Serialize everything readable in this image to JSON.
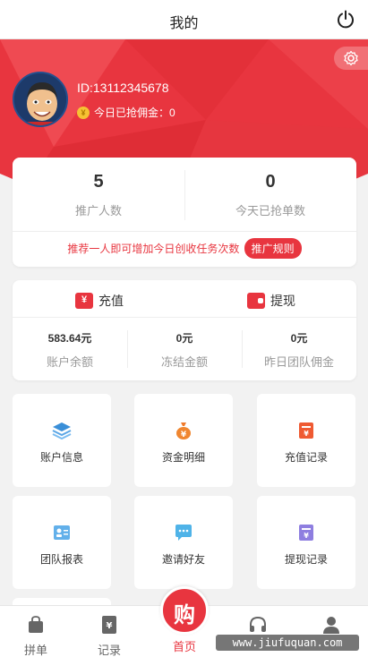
{
  "header": {
    "title": "我的"
  },
  "profile": {
    "uid": "ID:13112345678",
    "today_label": "今日已抢佣金：0",
    "coin_glyph": "¥"
  },
  "stats": {
    "items": [
      {
        "value": "5",
        "label": "推广人数"
      },
      {
        "value": "0",
        "label": "今天已抢单数"
      }
    ],
    "promo_text": "推荐一人即可增加今日创收任务次数",
    "rule_button": "推广规则"
  },
  "wallet": {
    "recharge": "充值",
    "withdraw": "提现",
    "balances": [
      {
        "value": "583.64元",
        "label": "账户余额"
      },
      {
        "value": "0元",
        "label": "冻结金额"
      },
      {
        "value": "0元",
        "label": "昨日团队佣金"
      }
    ]
  },
  "menu": [
    {
      "label": "账户信息",
      "icon": "layers-icon"
    },
    {
      "label": "资金明细",
      "icon": "money-bag-icon"
    },
    {
      "label": "充值记录",
      "icon": "recharge-record-icon"
    },
    {
      "label": "团队报表",
      "icon": "team-report-icon"
    },
    {
      "label": "邀请好友",
      "icon": "chat-invite-icon"
    },
    {
      "label": "提现记录",
      "icon": "withdraw-record-icon"
    }
  ],
  "tabbar": {
    "items": [
      "拼单",
      "记录",
      "首页",
      "",
      ""
    ],
    "active": 2,
    "center_glyph": "购"
  },
  "watermark": "www.jiufuquan.com",
  "colors": {
    "brand": "#e8353f",
    "coin": "#f6c233",
    "muted": "#999999"
  }
}
